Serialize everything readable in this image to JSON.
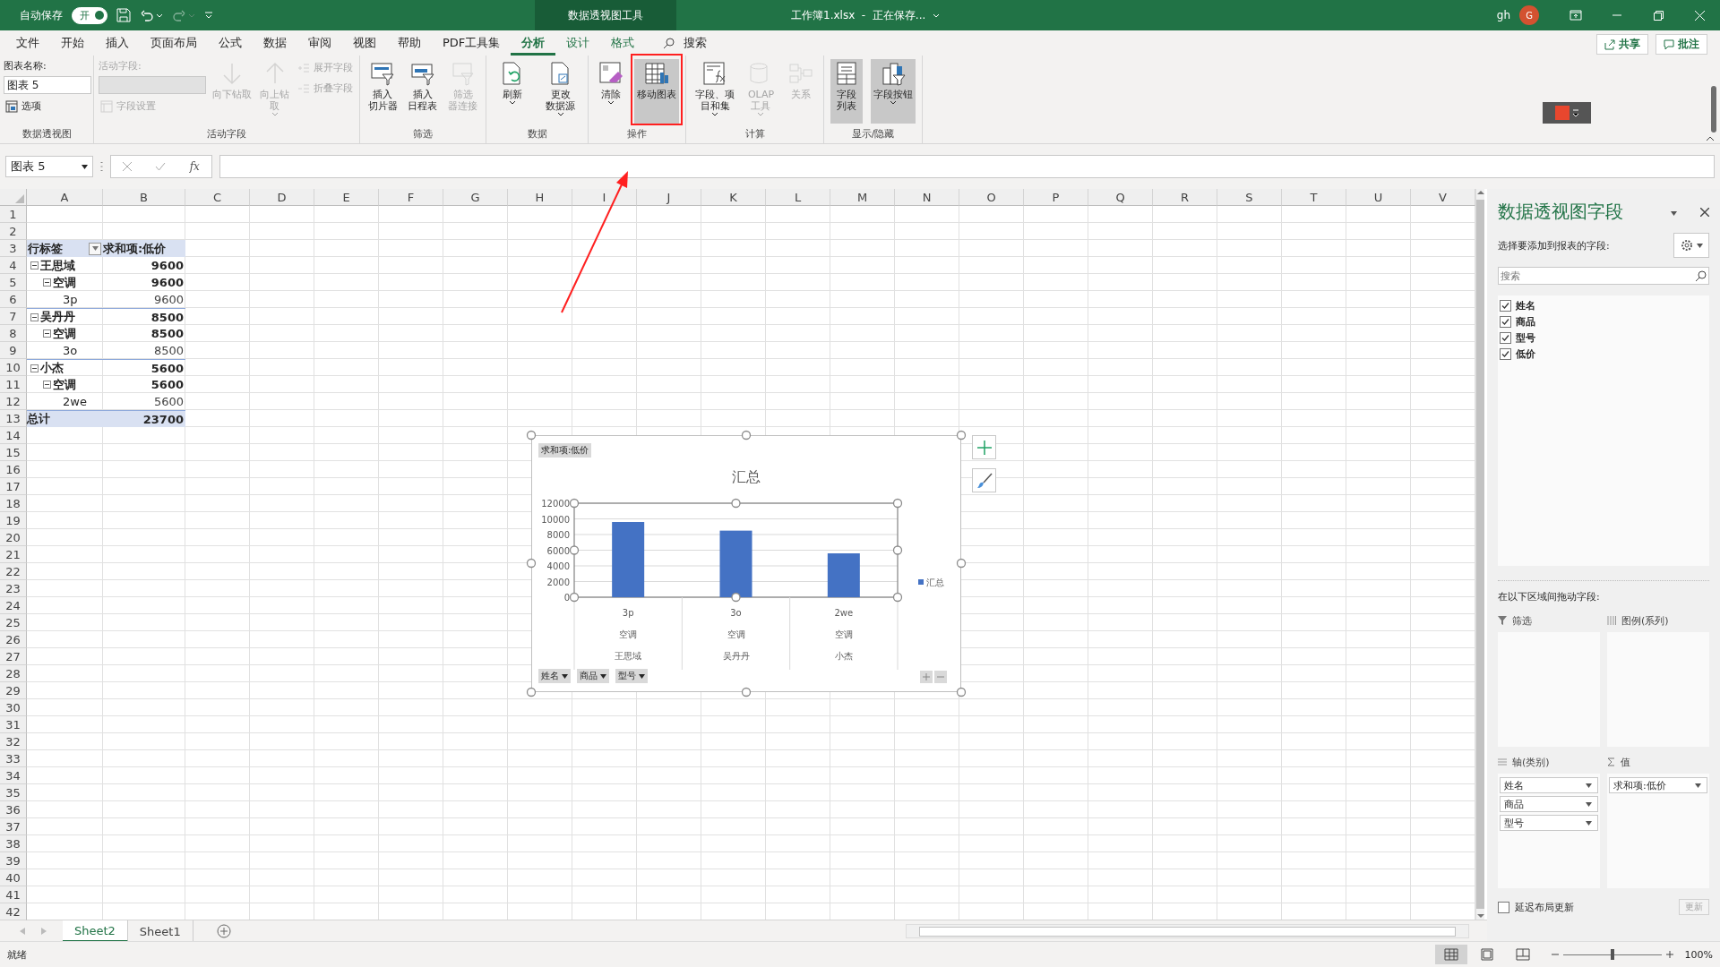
{
  "title_bar": {
    "autosave_label": "自动保存",
    "autosave_toggle": {
      "label": "开",
      "on": true
    },
    "context_group": "数据透视图工具",
    "document_title": "工作簿1.xlsx  -  正在保存...",
    "user": "gh",
    "avatar_initial": "G"
  },
  "menu_tabs": [
    {
      "label": "文件",
      "selected": false,
      "contextual": false
    },
    {
      "label": "开始",
      "selected": false,
      "contextual": false
    },
    {
      "label": "插入",
      "selected": false,
      "contextual": false
    },
    {
      "label": "页面布局",
      "selected": false,
      "contextual": false
    },
    {
      "label": "公式",
      "selected": false,
      "contextual": false
    },
    {
      "label": "数据",
      "selected": false,
      "contextual": false
    },
    {
      "label": "审阅",
      "selected": false,
      "contextual": false
    },
    {
      "label": "视图",
      "selected": false,
      "contextual": false
    },
    {
      "label": "帮助",
      "selected": false,
      "contextual": false
    },
    {
      "label": "PDF工具集",
      "selected": false,
      "contextual": false
    },
    {
      "label": "分析",
      "selected": true,
      "contextual": true
    },
    {
      "label": "设计",
      "selected": false,
      "contextual": true
    },
    {
      "label": "格式",
      "selected": false,
      "contextual": true
    }
  ],
  "search": {
    "label": "搜索"
  },
  "share_button": "共享",
  "comment_button": "批注",
  "ribbon": {
    "groups": [
      {
        "title": "数据透视图",
        "columns": [
          [
            {
              "kind": "label",
              "text": "图表名称:",
              "disabled": false
            },
            {
              "kind": "field",
              "value": "图表 5",
              "disabled": false
            },
            {
              "kind": "small",
              "label": "选项",
              "disabled": false
            }
          ]
        ]
      },
      {
        "title": "活动字段",
        "columns": [
          [
            {
              "kind": "label",
              "text": "活动字段:",
              "disabled": true
            },
            {
              "kind": "field",
              "disabled": true
            },
            {
              "kind": "small",
              "label": "字段设置",
              "disabled": true
            }
          ],
          [
            {
              "kind": "large",
              "lines": [
                "向下钻取"
              ],
              "disabled": true,
              "dropdown": false,
              "selected": false
            }
          ],
          [
            {
              "kind": "large",
              "lines": [
                "向上钻",
                "取"
              ],
              "disabled": true,
              "dropdown": true,
              "selected": false
            }
          ],
          [
            {
              "kind": "small",
              "label": "展开字段",
              "disabled": true
            },
            {
              "kind": "small",
              "label": "折叠字段",
              "disabled": true
            }
          ]
        ]
      },
      {
        "title": "筛选",
        "columns": [
          [
            {
              "kind": "large",
              "lines": [
                "插入",
                "切片器"
              ],
              "disabled": false,
              "dropdown": false,
              "selected": false
            }
          ],
          [
            {
              "kind": "large",
              "lines": [
                "插入",
                "日程表"
              ],
              "disabled": false,
              "dropdown": false,
              "selected": false
            }
          ],
          [
            {
              "kind": "large",
              "lines": [
                "筛选",
                "器连接"
              ],
              "disabled": true,
              "dropdown": false,
              "selected": false
            }
          ]
        ]
      },
      {
        "title": "数据",
        "columns": [
          [
            {
              "kind": "large",
              "lines": [
                "刷新"
              ],
              "disabled": false,
              "dropdown": true,
              "selected": false
            }
          ],
          [
            {
              "kind": "large",
              "lines": [
                "更改",
                "数据源"
              ],
              "disabled": false,
              "dropdown": true,
              "selected": false
            }
          ]
        ]
      },
      {
        "title": "操作",
        "columns": [
          [
            {
              "kind": "large",
              "lines": [
                "清除"
              ],
              "disabled": false,
              "dropdown": true,
              "selected": false
            }
          ],
          [
            {
              "kind": "large",
              "lines": [
                "移动图表"
              ],
              "disabled": false,
              "dropdown": false,
              "selected": true
            }
          ]
        ]
      },
      {
        "title": "计算",
        "columns": [
          [
            {
              "kind": "large",
              "lines": [
                "字段、项",
                "目和集"
              ],
              "disabled": false,
              "dropdown": true,
              "selected": false
            }
          ],
          [
            {
              "kind": "large",
              "lines": [
                "OLAP",
                "工具"
              ],
              "disabled": true,
              "dropdown": true,
              "selected": false
            }
          ],
          [
            {
              "kind": "large",
              "lines": [
                "关系"
              ],
              "disabled": true,
              "dropdown": false,
              "selected": false
            }
          ]
        ]
      },
      {
        "title": "显示/隐藏",
        "columns": [
          [
            {
              "kind": "large",
              "lines": [
                "字段",
                "列表"
              ],
              "disabled": false,
              "dropdown": false,
              "selected": true
            }
          ],
          [
            {
              "kind": "large",
              "lines": [
                "字段按钮"
              ],
              "disabled": false,
              "dropdown": true,
              "selected": true
            }
          ]
        ]
      }
    ]
  },
  "formula_bar": {
    "name_box": "图表 5",
    "function_label": "fx"
  },
  "sheet": {
    "columns": [
      "A",
      "B",
      "C",
      "D",
      "E",
      "F",
      "G",
      "H",
      "I",
      "J",
      "K",
      "L",
      "M",
      "N",
      "O",
      "P",
      "Q",
      "R",
      "S",
      "T",
      "U",
      "V"
    ],
    "row_numbers": [
      "1",
      "2",
      "3",
      "4",
      "5",
      "6",
      "7",
      "8",
      "9",
      "10",
      "11",
      "12",
      "13",
      "14",
      "15",
      "16",
      "17",
      "18",
      "19",
      "20",
      "21",
      "22",
      "23",
      "24",
      "25",
      "26",
      "27",
      "28",
      "29",
      "30",
      "31",
      "32",
      "33",
      "34",
      "35",
      "36",
      "37",
      "38",
      "39",
      "40",
      "41",
      "42"
    ],
    "pivot": {
      "row_label": "行标签",
      "value_label": "求和项:低价",
      "groups": [
        {
          "label": "王思域",
          "value": "9600",
          "expanded": true,
          "children": [
            {
              "label": "空调",
              "value": "9600",
              "expanded": true,
              "children": [
                {
                  "label": "3p",
                  "value": "9600"
                }
              ]
            }
          ]
        },
        {
          "label": "吴丹丹",
          "value": "8500",
          "expanded": true,
          "children": [
            {
              "label": "空调",
              "value": "8500",
              "expanded": true,
              "children": [
                {
                  "label": "3o",
                  "value": "8500"
                }
              ]
            }
          ]
        },
        {
          "label": "小杰",
          "value": "5600",
          "expanded": true,
          "children": [
            {
              "label": "空调",
              "value": "5600",
              "expanded": true,
              "children": [
                {
                  "label": "2we",
                  "value": "5600"
                }
              ]
            }
          ]
        }
      ],
      "total": {
        "label": "总计",
        "value": "23700"
      }
    }
  },
  "chart": {
    "value_field_button": "求和项:低价",
    "chart_data": {
      "type": "bar",
      "title": "汇总",
      "categories": [
        "3p",
        "3o",
        "2we"
      ],
      "series": [
        {
          "name": "汇总",
          "color": "#4472c4",
          "values": [
            9600,
            8500,
            5600
          ]
        }
      ],
      "grid": true,
      "ylim": [
        0,
        12000
      ],
      "yticks": [
        0,
        2000,
        4000,
        6000,
        8000,
        10000,
        12000
      ]
    },
    "category_groups": [
      {
        "product": "空调",
        "name": "王思域"
      },
      {
        "product": "空调",
        "name": "吴丹丹"
      },
      {
        "product": "空调",
        "name": "小杰"
      }
    ],
    "axis_field_buttons": [
      "姓名",
      "商品",
      "型号"
    ]
  },
  "sheet_tabs": [
    {
      "label": "Sheet2",
      "selected": true
    },
    {
      "label": "Sheet1",
      "selected": false
    }
  ],
  "field_pane": {
    "title": "数据透视图字段",
    "subtitle": "选择要添加到报表的字段:",
    "search_placeholder": "搜索",
    "fields": [
      {
        "label": "姓名",
        "checked": true
      },
      {
        "label": "商品",
        "checked": true
      },
      {
        "label": "型号",
        "checked": true
      },
      {
        "label": "低价",
        "checked": true
      }
    ],
    "drag_hint": "在以下区域间拖动字段:",
    "areas": [
      {
        "kind": "filter",
        "title": "筛选"
      },
      {
        "kind": "legend",
        "title": "图例(系列)"
      },
      {
        "kind": "axis",
        "title": "轴(类别)",
        "items": [
          "姓名",
          "商品",
          "型号"
        ]
      },
      {
        "kind": "values",
        "title": "值",
        "items": [
          "求和项:低价"
        ]
      }
    ],
    "defer_update": {
      "label": "延迟布局更新",
      "checked": false
    },
    "update_button": "更新"
  },
  "status_bar": {
    "status": "就绪",
    "views": [
      {
        "kind": "normal",
        "selected": true
      },
      {
        "kind": "page_layout",
        "selected": false
      },
      {
        "kind": "page_break",
        "selected": false
      }
    ],
    "zoom": {
      "level": 0.5,
      "reading": "100%"
    }
  }
}
